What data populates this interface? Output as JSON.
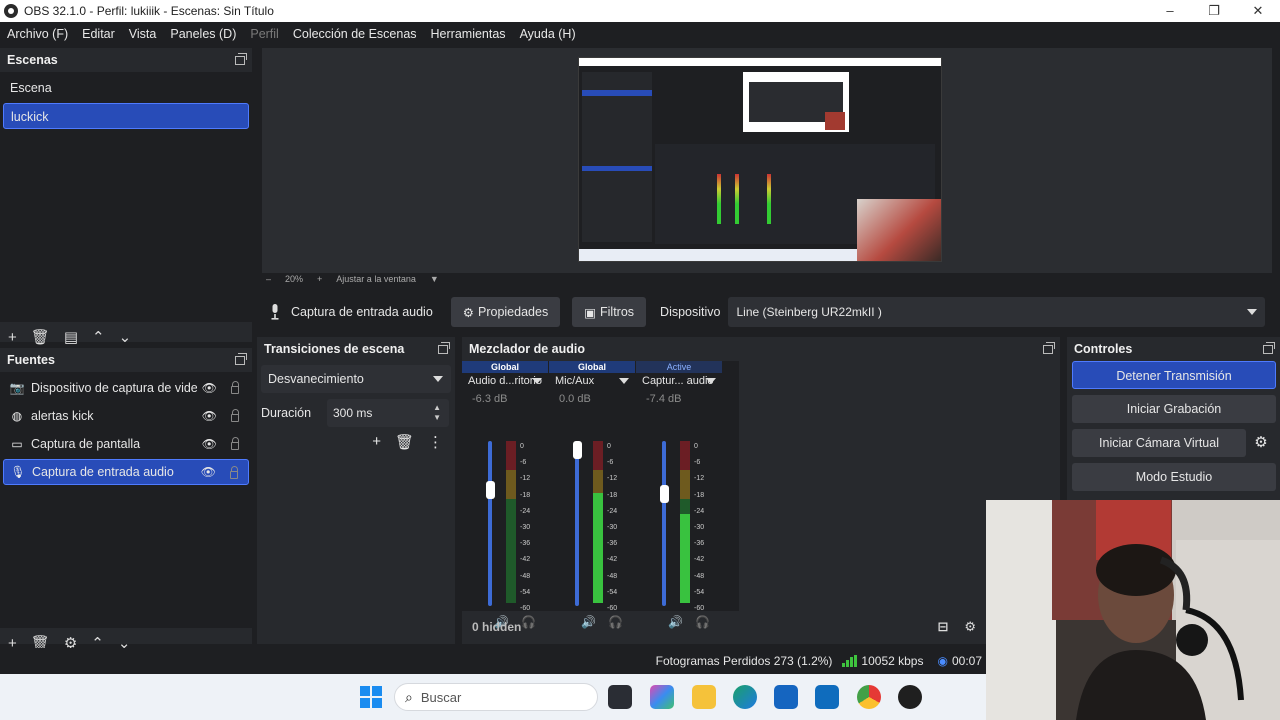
{
  "window": {
    "title": "OBS 32.1.0 - Perfil: lukiiik - Escenas: Sin Título",
    "controls": [
      "–",
      "❐",
      "✕"
    ]
  },
  "menu": {
    "items": [
      "Archivo (F)",
      "Editar",
      "Vista",
      "Paneles (D)",
      "Perfil",
      "Colección de Escenas",
      "Herramientas",
      "Ayuda (H)"
    ],
    "disabled_index": 4
  },
  "scenes": {
    "title": "Escenas",
    "items": [
      "Escena",
      "luckick"
    ],
    "selected": "luckick"
  },
  "preview": {
    "zoom": "20%",
    "fit_label": "Ajustar a la ventana"
  },
  "source_toolbar": {
    "source_name": "Captura de entrada audio",
    "properties_label": "Propiedades",
    "filters_label": "Filtros",
    "device_label": "Dispositivo",
    "device_value": "Line (Steinberg UR22mkII )"
  },
  "sources": {
    "title": "Fuentes",
    "items": [
      {
        "name": "Dispositivo de captura de video",
        "icon": "camera-icon"
      },
      {
        "name": "alertas kick",
        "icon": "globe-icon"
      },
      {
        "name": "Captura de pantalla",
        "icon": "monitor-icon"
      },
      {
        "name": "Captura de entrada audio",
        "icon": "mic-icon"
      }
    ],
    "selected_index": 3
  },
  "transitions": {
    "title": "Transiciones de escena",
    "selected": "Desvanecimiento",
    "duration_label": "Duración",
    "duration_value": "300 ms"
  },
  "mixer": {
    "title": "Mezclador de audio",
    "channels": [
      {
        "tag": "Global",
        "name": "Audio d...ritorio",
        "db": "-6.3 dB",
        "fader": 0.73,
        "level": 0.0
      },
      {
        "tag": "Global",
        "name": "Mic/Aux",
        "db": "0.0 dB",
        "fader": 1.0,
        "level": 0.68
      },
      {
        "tag": "Active",
        "name": "Captur... audio",
        "db": "-7.4 dB",
        "fader": 0.7,
        "level": 0.55
      }
    ],
    "ticks": [
      "0",
      "-6",
      "-12",
      "-18",
      "-24",
      "-30",
      "-36",
      "-42",
      "-48",
      "-54",
      "-60"
    ],
    "hidden_label": "0 hidden"
  },
  "controls": {
    "title": "Controles",
    "stop_stream": "Detener Transmisión",
    "start_recording": "Iniciar Grabación",
    "start_virtual_cam": "Iniciar Cámara Virtual",
    "studio_mode": "Modo Estudio"
  },
  "status": {
    "dropped_frames": "Fotogramas Perdidos 273 (1.2%)",
    "bitrate": "10052 kbps",
    "time": "00:07"
  },
  "taskbar": {
    "search_placeholder": "Buscar"
  },
  "colors": {
    "accent": "#284cb8",
    "panel": "#27292d",
    "background": "#1e1f22"
  }
}
